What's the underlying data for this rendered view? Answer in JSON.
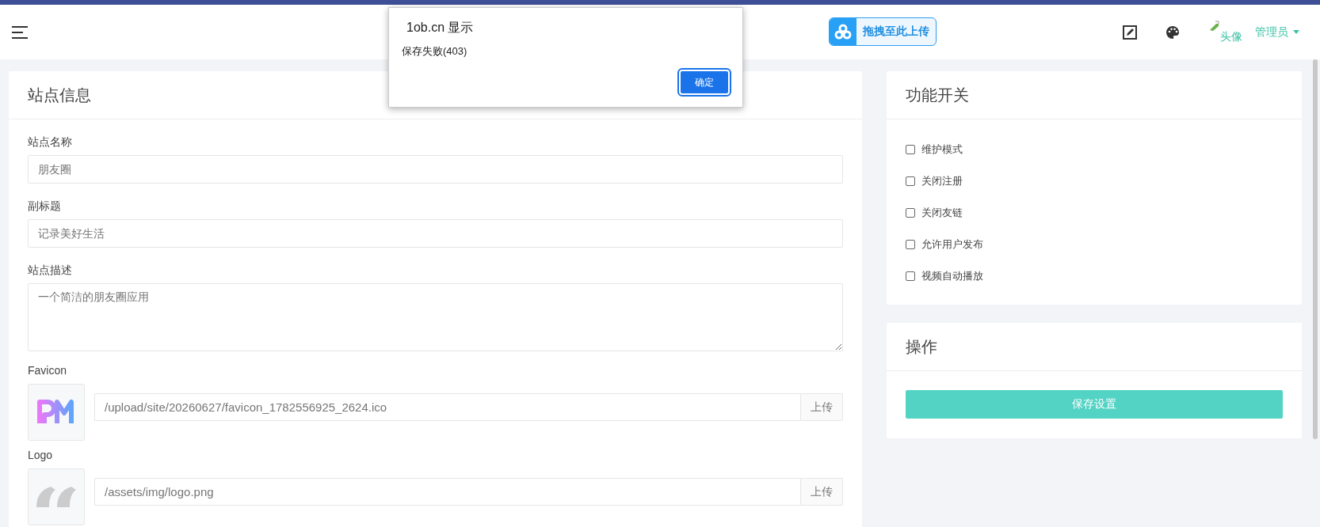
{
  "header": {
    "upload_widget": "拖拽至此上传",
    "avatar_alt": "头像",
    "user": "管理员"
  },
  "site_info": {
    "title": "站点信息",
    "fields": [
      {
        "kind": "input",
        "label": "站点名称",
        "placeholder": "朋友圈"
      },
      {
        "kind": "input",
        "label": "副标题",
        "placeholder": "记录美好生活"
      },
      {
        "kind": "textarea",
        "label": "站点描述",
        "placeholder": "一个简洁的朋友圈应用"
      },
      {
        "kind": "image",
        "label": "Favicon",
        "value": "/upload/site/20260627/favicon_1782556925_2624.ico",
        "button": "上传"
      },
      {
        "kind": "image",
        "label": "Logo",
        "value": "/assets/img/logo.png",
        "button": "上传"
      }
    ]
  },
  "switches": {
    "title": "功能开关",
    "items": [
      {
        "label": "维护模式",
        "checked": false
      },
      {
        "label": "关闭注册",
        "checked": false
      },
      {
        "label": "关闭友链",
        "checked": false
      },
      {
        "label": "允许用户发布",
        "checked": false
      },
      {
        "label": "视频自动播放",
        "checked": false
      }
    ]
  },
  "actions": {
    "title": "操作",
    "button": "保存设置"
  },
  "dialog": {
    "title": "1ob.cn 显示",
    "message": "保存失败(403)",
    "button": "确定"
  }
}
